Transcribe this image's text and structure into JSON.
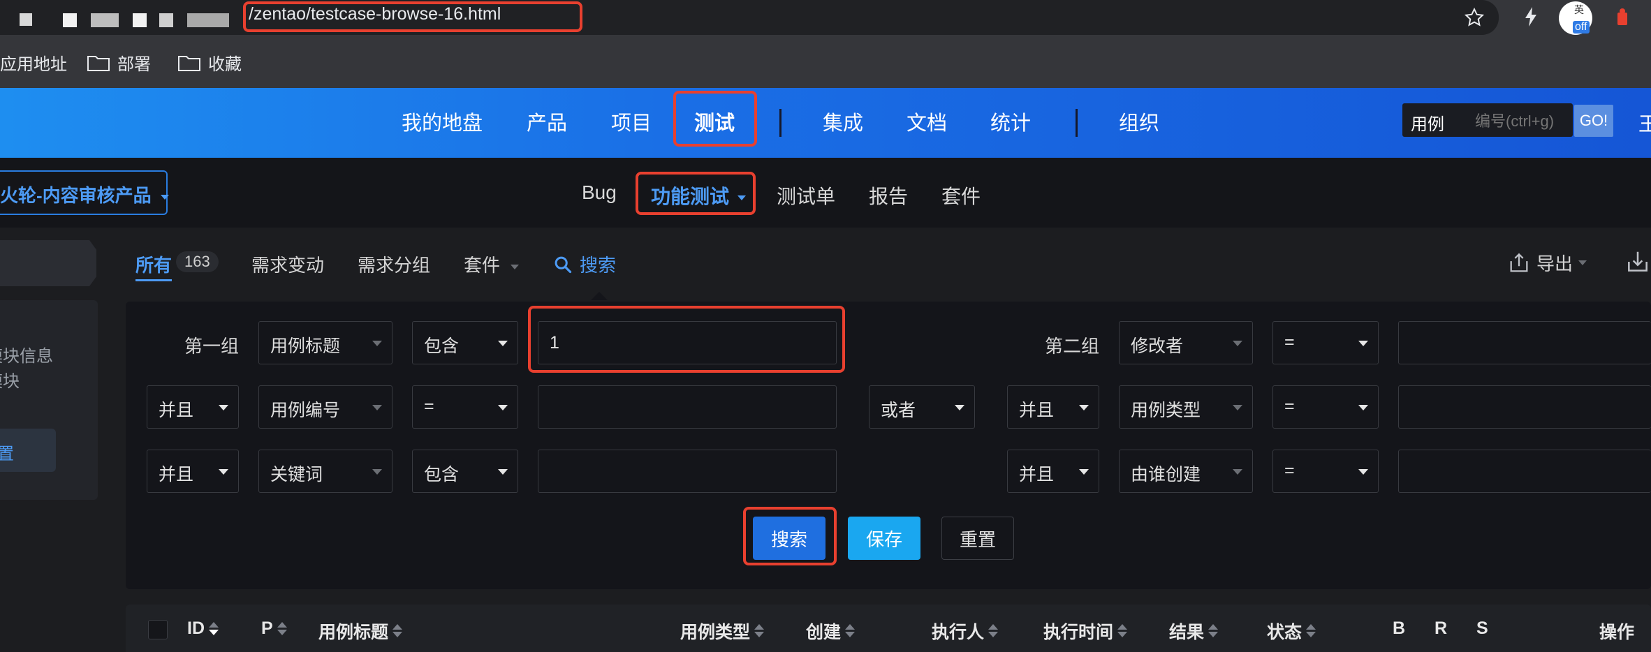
{
  "browser": {
    "url": "/zentao/testcase-browse-16.html",
    "bookmarks": [
      "应用地址",
      "部署",
      "收藏"
    ],
    "extension_badge": "off",
    "extension_char": "英"
  },
  "main_nav": {
    "items": [
      "我的地盘",
      "产品",
      "项目",
      "测试",
      "集成",
      "文档",
      "统计",
      "组织"
    ],
    "active": "测试",
    "search_type": "用例",
    "search_placeholder": "编号(ctrl+g)",
    "go_label": "GO!",
    "user_char": "王"
  },
  "product_selector": {
    "name": "火轮-内容审核产品"
  },
  "sub_nav": {
    "items": [
      "Bug",
      "功能测试",
      "测试单",
      "报告",
      "套件"
    ],
    "active": "功能测试"
  },
  "tabs": {
    "all_label": "所有",
    "all_count": "163",
    "items": [
      "需求变动",
      "需求分组",
      "套件"
    ],
    "search_label": "搜索",
    "export_label": "导出"
  },
  "sidebar": {
    "text1": "模块信息",
    "text2": "模块",
    "button": "置"
  },
  "search_form": {
    "group1_label": "第一组",
    "group2_label": "第二组",
    "row1": {
      "field1": "用例标题",
      "op1": "包含",
      "value1": "1",
      "field2": "修改者",
      "op2": "="
    },
    "row2": {
      "join1": "并且",
      "field1": "用例编号",
      "op1": "=",
      "or_label": "或者",
      "join2": "并且",
      "field2": "用例类型",
      "op2": "="
    },
    "row3": {
      "join1": "并且",
      "field1": "关键词",
      "op1": "包含",
      "join2": "并且",
      "field2": "由谁创建",
      "op2": "="
    },
    "buttons": {
      "search": "搜索",
      "save": "保存",
      "reset": "重置"
    }
  },
  "table": {
    "columns": [
      "ID",
      "P",
      "用例标题",
      "用例类型",
      "创建",
      "执行人",
      "执行时间",
      "结果",
      "状态",
      "B",
      "R",
      "S",
      "操作"
    ]
  },
  "colors": {
    "accent": "#1f6fe0",
    "highlight": "#e8402f",
    "nav_gradient_start": "#1e8ef0"
  }
}
